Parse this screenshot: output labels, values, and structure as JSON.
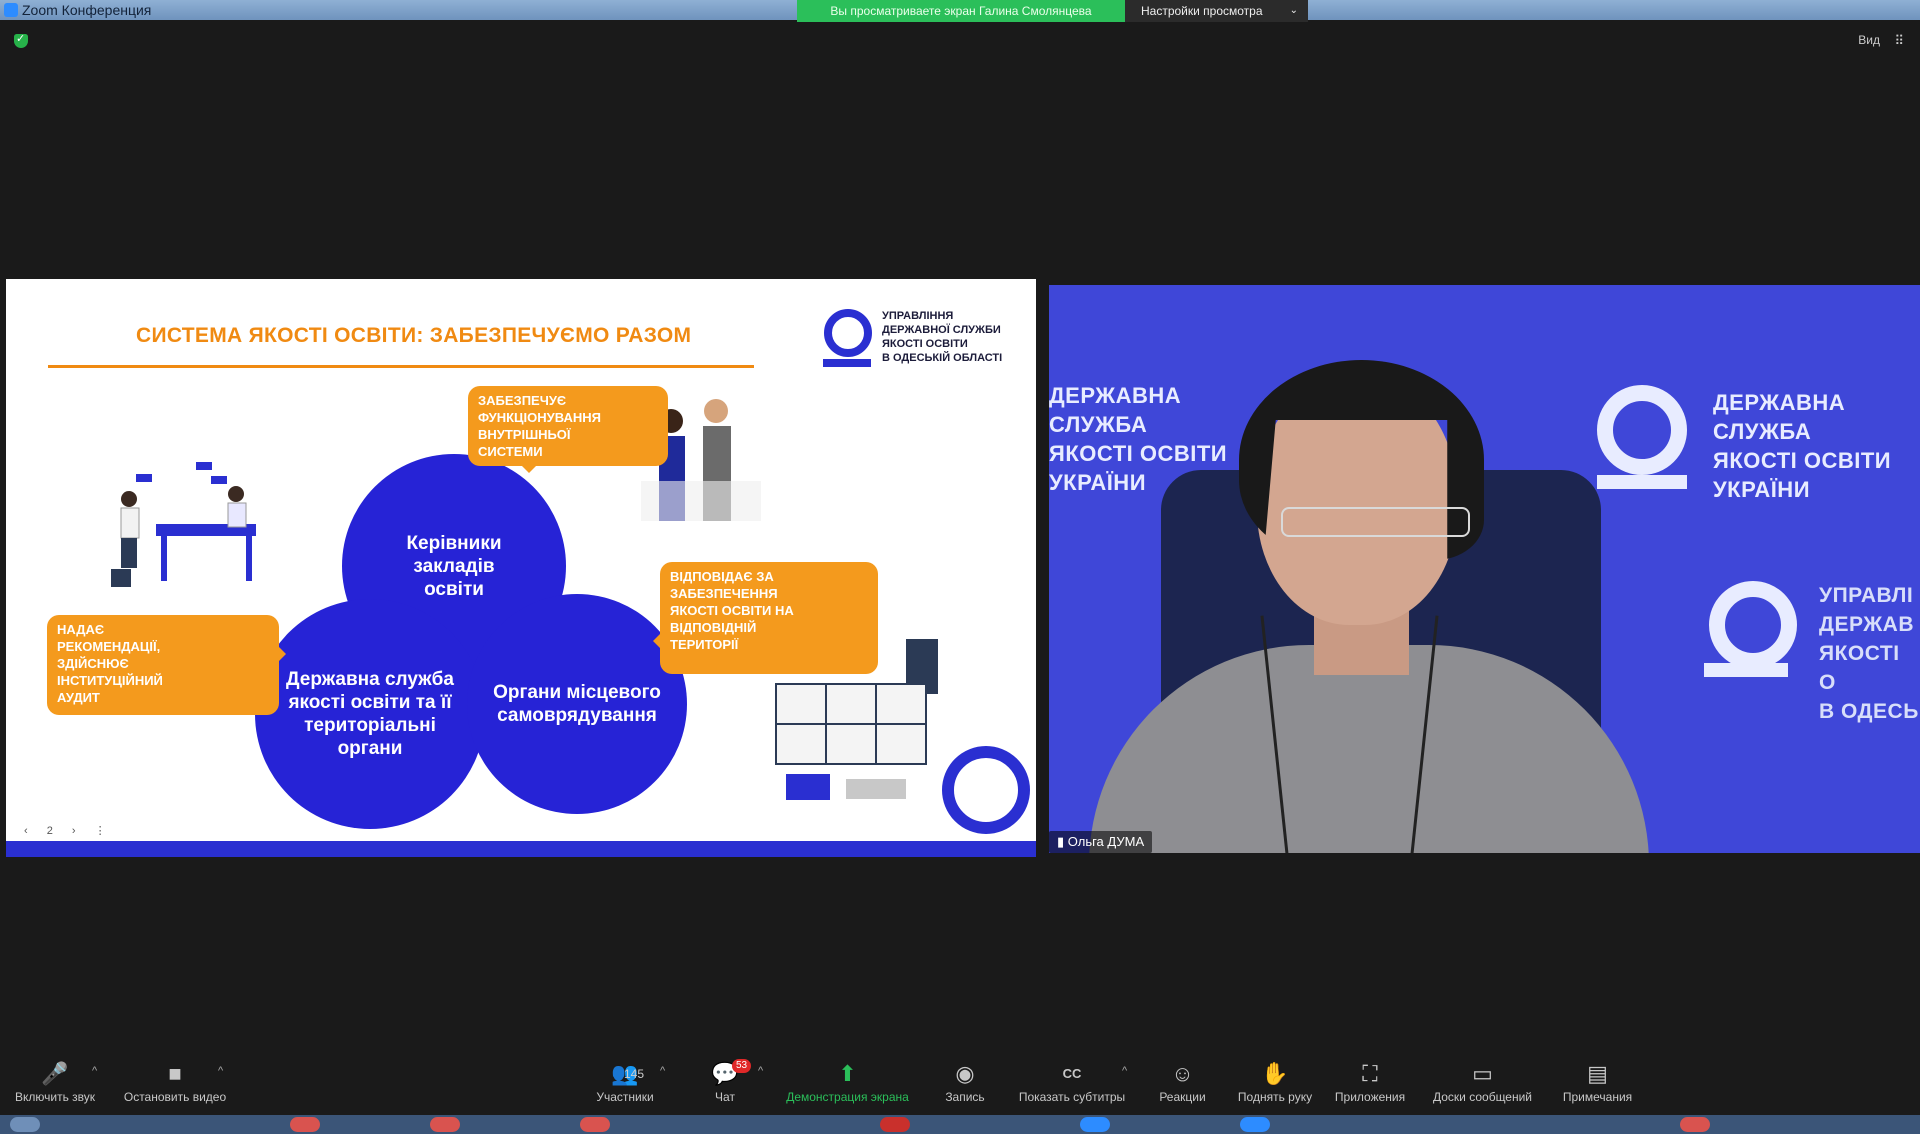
{
  "window": {
    "title": "Zoom Конференция",
    "share_banner": "Вы просматриваете экран Галина Смолянцева",
    "view_options": "Настройки просмотра",
    "view_toggle": "Вид"
  },
  "slide": {
    "title": "СИСТЕМА ЯКОСТІ ОСВІТИ: ЗАБЕЗПЕЧУЄМО РАЗОМ",
    "org_name": "УПРАВЛІННЯ\nДЕРЖАВНОЇ СЛУЖБИ\nЯКОСТІ ОСВІТИ\nВ ОДЕСЬКІЙ ОБЛАСТІ",
    "circles": {
      "top": "Керівники закладів\nосвіти",
      "left": "Державна служба\nякості освіти та її\nтериторіальні\nоргани",
      "right": "Органи місцевого\nсамоврядування"
    },
    "bubbles": {
      "top": "Забезпечує\nфункціонування\nвнутрішньої\nсистеми",
      "left": "Надає\nрекомендації,\nздійснює\nінституційний\nаудит",
      "right": "Відповідає за\nзабезпечення\nякості освіти на\nвідповідній\nтериторії"
    },
    "nav": [
      "‹",
      "2",
      "›",
      "⋮"
    ]
  },
  "video": {
    "wall_left": "ДЕРЖАВНА\nСЛУЖБА\nЯКОСТІ ОСВІТИ\nУКРАЇНИ",
    "wall_right": "ДЕРЖАВНА\nСЛУЖБА\nЯКОСТІ ОСВІТИ\nУКРАЇНИ",
    "wall_lower": "УПРАВЛІ\nДЕРЖАВ\nЯКОСТІ О\nВ ОДЕСЬ",
    "participant_name": "Ольга ДУМА"
  },
  "toolbar": {
    "unmute": "Включить звук",
    "stop_video": "Остановить видео",
    "participants": "Участники",
    "participants_count": "145",
    "chat": "Чат",
    "chat_badge": "53",
    "share": "Демонстрация экрана",
    "record": "Запись",
    "subtitles": "Показать субтитры",
    "reactions": "Реакции",
    "raise_hand": "Поднять руку",
    "apps": "Приложения",
    "whiteboards": "Доски сообщений",
    "notes": "Примечания"
  },
  "colors": {
    "brand_blue": "#2a2fd1",
    "accent_orange": "#f08a12",
    "share_green": "#2bbf5a"
  }
}
